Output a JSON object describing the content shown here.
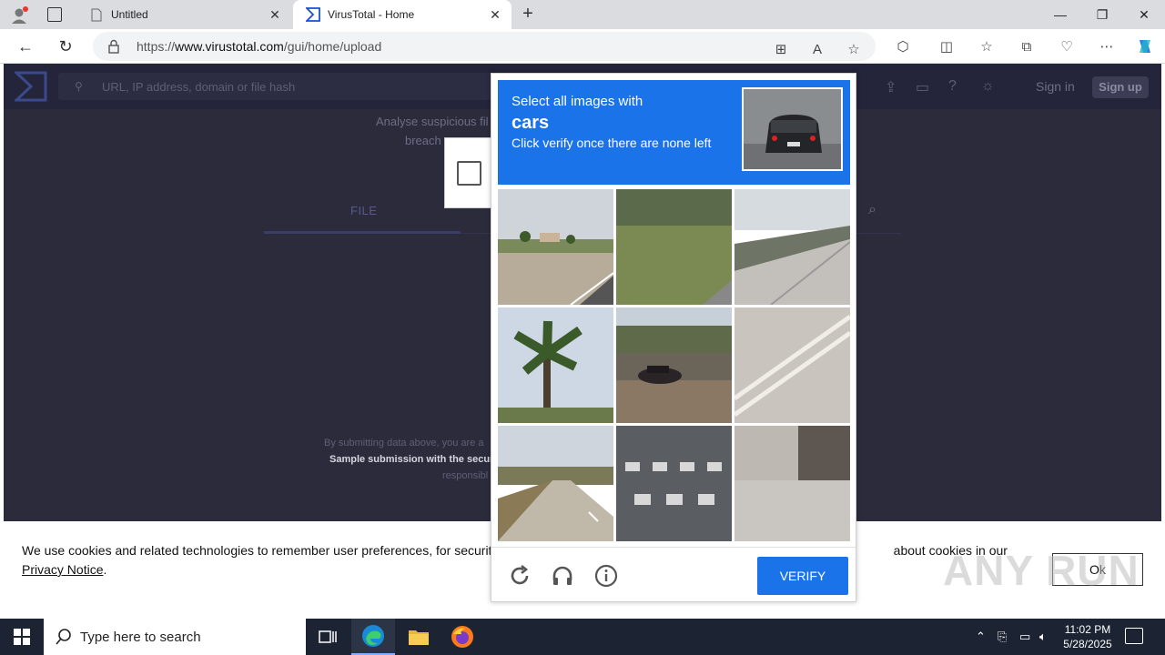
{
  "browser": {
    "tabs": [
      {
        "title": "Untitled"
      },
      {
        "title": "VirusTotal - Home"
      }
    ],
    "url_prefix": "https://",
    "url_host": "www.virustotal.com",
    "url_path": "/gui/home/upload"
  },
  "virustotal": {
    "search_placeholder": "URL, IP address, domain or file hash",
    "sign_in": "Sign in",
    "sign_up": "Sign up",
    "analyse_text": "Analyse suspicious fil",
    "breach_text": "breach",
    "file_tab": "FILE",
    "submit_line1": "By submitting data above, you are a",
    "submit_line2": "Sample submission with the secur",
    "submit_line3": "responsibl"
  },
  "cookie": {
    "text_before": "We use cookies and related technologies to remember user preferences, for security, to",
    "text_after": "about cookies in our",
    "link_part1": "Privacy",
    "link_part2": "Notice",
    "period": ".",
    "ok_label": "Ok"
  },
  "captcha": {
    "line1": "Select all images with",
    "line2": "cars",
    "line3": "Click verify once there are none left",
    "verify_label": "VERIFY",
    "tiles": [
      "road with palm trees",
      "grass field",
      "highway with railing",
      "palm tree",
      "car on road",
      "road markings",
      "country road",
      "crosswalk",
      "sidewalk"
    ]
  },
  "watermark": "ANY RUN",
  "taskbar": {
    "search_placeholder": "Type here to search",
    "time": "11:02 PM",
    "date": "5/28/2025"
  },
  "colors": {
    "vt_bg": "#2b2b3c",
    "captcha_blue": "#1a73e8",
    "taskbar": "#1c2433"
  }
}
